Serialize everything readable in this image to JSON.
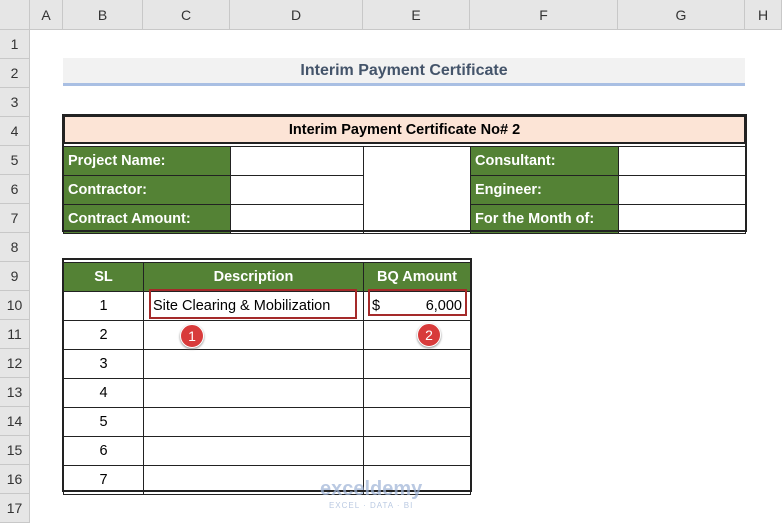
{
  "columns": [
    "A",
    "B",
    "C",
    "D",
    "E",
    "F",
    "G",
    "H"
  ],
  "rows": [
    "1",
    "2",
    "3",
    "4",
    "5",
    "6",
    "7",
    "8",
    "9",
    "10",
    "11",
    "12",
    "13",
    "14",
    "15",
    "16",
    "17"
  ],
  "title": "Interim Payment Certificate",
  "certificate": {
    "header": "Interim Payment Certificate No# 2",
    "left_labels": [
      "Project Name:",
      "Contractor:",
      "Contract Amount:"
    ],
    "right_labels": [
      "Consultant:",
      "Engineer:",
      "For the Month of:"
    ]
  },
  "bq": {
    "headers": [
      "SL",
      "Description",
      "BQ Amount"
    ],
    "rows": [
      {
        "sl": "1",
        "desc": "Site Clearing & Mobilization",
        "cur": "$",
        "amt": "6,000"
      },
      {
        "sl": "2"
      },
      {
        "sl": "3"
      },
      {
        "sl": "4"
      },
      {
        "sl": "5"
      },
      {
        "sl": "6"
      },
      {
        "sl": "7"
      }
    ]
  },
  "badges": [
    "1",
    "2"
  ],
  "watermark": "exceldemy",
  "watermark_sub": "EXCEL · DATA · BI"
}
